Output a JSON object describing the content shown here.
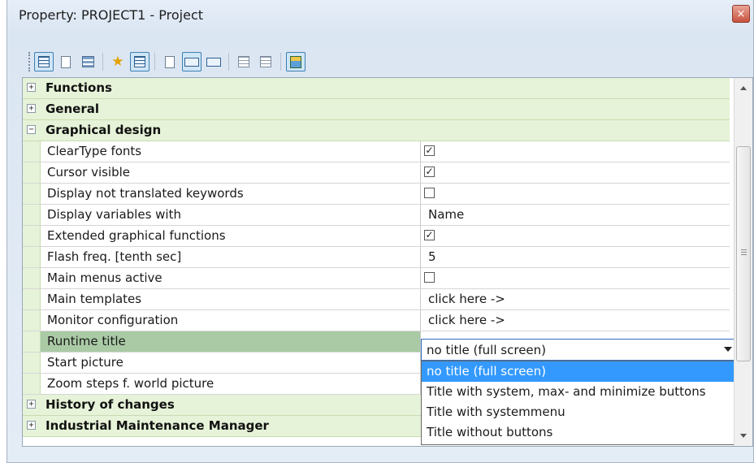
{
  "window": {
    "title": "Property: PROJECT1 - Project",
    "close_glyph": "×"
  },
  "toolbar": {
    "buttons": [
      {
        "icon": "grid-view-icon",
        "active": true
      },
      {
        "icon": "page-icon"
      },
      {
        "icon": "rows-icon"
      },
      {
        "icon": "favorites-star-icon"
      },
      {
        "icon": "grid-select-icon",
        "active": true
      },
      {
        "icon": "page-icon"
      },
      {
        "icon": "combo-icon",
        "active": true
      },
      {
        "icon": "combo-icon"
      },
      {
        "icon": "list-icon"
      },
      {
        "icon": "list-icon"
      },
      {
        "icon": "calculator-icon",
        "active": true
      }
    ]
  },
  "property_grid": {
    "categories": {
      "functions": "Functions",
      "general": "General",
      "graphical_design": "Graphical design",
      "history_of_changes": "History of changes",
      "industrial_maintenance_manager": "Industrial Maintenance Manager"
    },
    "expand_glyphs": {
      "collapsed": "+",
      "expanded": "−"
    },
    "check_glyph": "✓",
    "properties": [
      {
        "name": "ClearType fonts",
        "type": "checkbox",
        "checked": true
      },
      {
        "name": "Cursor visible",
        "type": "checkbox",
        "checked": true
      },
      {
        "name": "Display not translated keywords",
        "type": "checkbox",
        "checked": false
      },
      {
        "name": "Display variables with",
        "type": "text",
        "value": "Name"
      },
      {
        "name": "Extended graphical functions",
        "type": "checkbox",
        "checked": true
      },
      {
        "name": "Flash freq. [tenth sec]",
        "type": "text",
        "value": "5"
      },
      {
        "name": "Main menus active",
        "type": "checkbox",
        "checked": false
      },
      {
        "name": "Main templates",
        "type": "text",
        "value": "click here ->"
      },
      {
        "name": "Monitor configuration",
        "type": "text",
        "value": "click here ->"
      },
      {
        "name": "Runtime title",
        "type": "combo",
        "value": "no title (full screen)",
        "selected": true
      },
      {
        "name": "Start picture",
        "type": "text",
        "value": ""
      },
      {
        "name": "Zoom steps f. world picture",
        "type": "text",
        "value": ""
      }
    ],
    "runtime_title_options": [
      "no title (full screen)",
      "Title with system, max- and minimize buttons",
      "Title with systemmenu",
      "Title without buttons"
    ]
  }
}
